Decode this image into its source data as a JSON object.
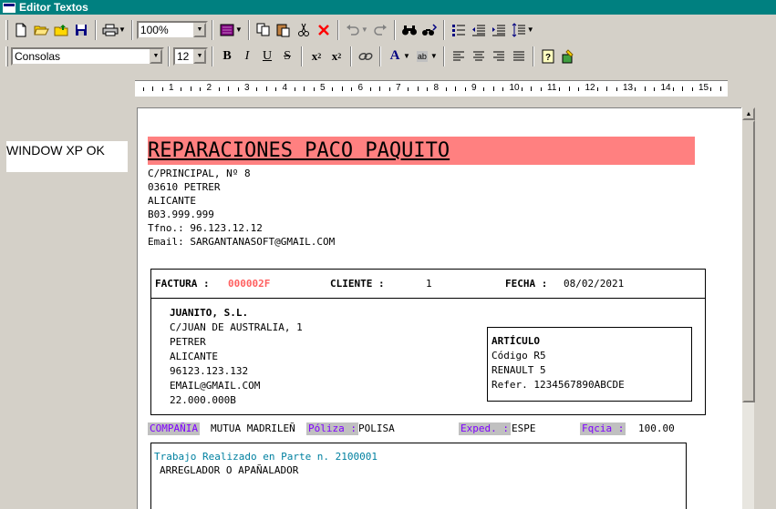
{
  "window": {
    "title": "Editor Textos"
  },
  "toolbar": {
    "zoom": "100%",
    "font": "Consolas",
    "size": "12"
  },
  "ruler": {
    "labels": [
      "1",
      "2",
      "3",
      "4",
      "5",
      "6",
      "7",
      "8",
      "9",
      "10",
      "11",
      "12",
      "13",
      "14",
      "15"
    ]
  },
  "left_label": "WINDOW XP  OK",
  "doc": {
    "company": "REPARACIONES PACO PAQUITO",
    "address": [
      "C/PRINCIPAL, Nº 8",
      "03610 PETRER",
      "ALICANTE",
      "B03.999.999",
      "Tfno.: 96.123.12.12",
      "Email: SARGANTANASOFT@GMAIL.COM"
    ],
    "invoice": {
      "factura_label": "FACTURA :",
      "factura_value": "000002F",
      "cliente_label": "CLIENTE :",
      "cliente_value": "1",
      "fecha_label": "FECHA :",
      "fecha_value": "08/02/2021"
    },
    "customer": [
      "JUANITO, S.L.",
      "C/JUAN DE AUSTRALIA, 1",
      "PETRER",
      "ALICANTE",
      "96123.123.132",
      "EMAIL@GMAIL.COM",
      "22.000.000B"
    ],
    "article": {
      "title": "ARTÍCULO",
      "lines": [
        "Código R5",
        "RENAULT 5",
        "Refer.  1234567890ABCDE"
      ]
    },
    "meta": {
      "compania_label": "COMPAÑIA",
      "compania_value": "MUTUA MADRILEÑ",
      "poliza_label": "Póliza :",
      "poliza_value": "POLISA",
      "exped_label": "Exped. :",
      "exped_value": "ESPE",
      "fqcia_label": "Fqcia :",
      "fqcia_value": "100.00"
    },
    "work": {
      "title": "Trabajo Realizado en Parte n.  2100001",
      "desc": "ARREGLADOR O APAÑALADOR"
    }
  },
  "colors": {
    "title_bar": "#008080",
    "company_bg": "#ff8080",
    "invoice_num": "#ff6060",
    "meta_label": "#8000ff",
    "work_title": "#0080a0"
  }
}
